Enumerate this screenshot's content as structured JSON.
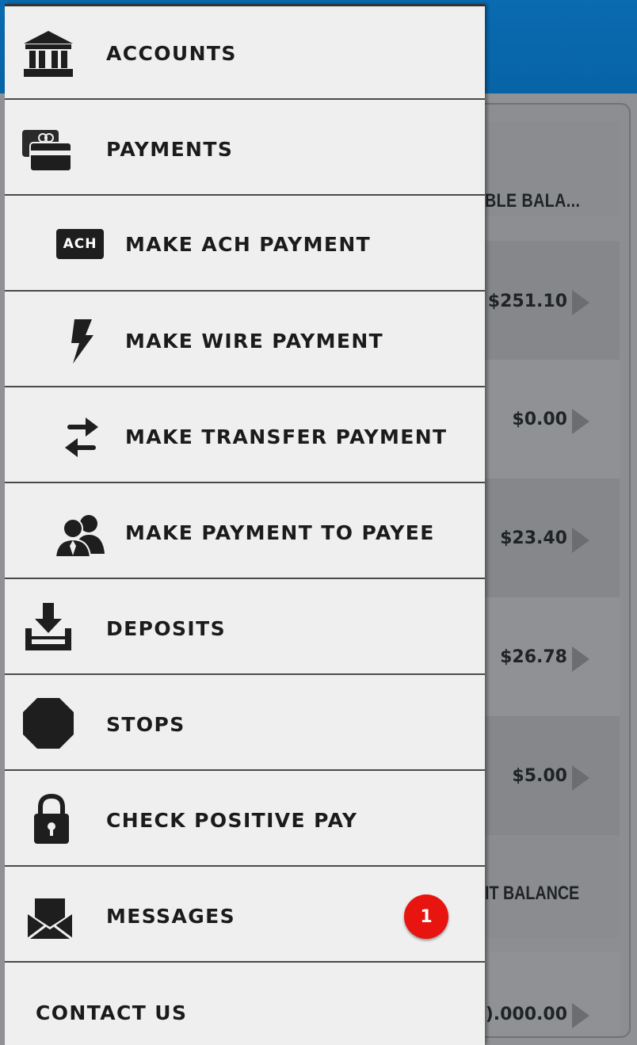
{
  "background": {
    "column_header": "BLE BALA...",
    "rows": [
      {
        "amount": "$251.10"
      },
      {
        "amount": "$0.00"
      },
      {
        "amount": "$23.40"
      },
      {
        "amount": "$26.78"
      },
      {
        "amount": "$5.00"
      }
    ],
    "section_header": "IT BALANCE",
    "last_amount": ").000.00"
  },
  "menu": {
    "items": [
      {
        "label": "ACCOUNTS",
        "icon": "bank-icon"
      },
      {
        "label": "PAYMENTS",
        "icon": "credit-cards-icon"
      },
      {
        "label": "MAKE ACH PAYMENT",
        "icon": "ach-icon",
        "icon_text": "ACH"
      },
      {
        "label": "MAKE WIRE PAYMENT",
        "icon": "lightning-bolt-icon"
      },
      {
        "label": "MAKE TRANSFER PAYMENT",
        "icon": "transfer-arrows-icon"
      },
      {
        "label": "MAKE PAYMENT TO PAYEE",
        "icon": "payee-people-icon"
      },
      {
        "label": "DEPOSITS",
        "icon": "download-tray-icon"
      },
      {
        "label": "STOPS",
        "icon": "stop-sign-icon"
      },
      {
        "label": "CHECK POSITIVE PAY",
        "icon": "padlock-icon"
      },
      {
        "label": "MESSAGES",
        "icon": "envelope-icon",
        "badge": "1"
      },
      {
        "label": "CONTACT US"
      }
    ]
  },
  "colors": {
    "header_blue": "#0763a6",
    "drawer_bg": "#f0efef",
    "badge_red": "#e8140f"
  }
}
